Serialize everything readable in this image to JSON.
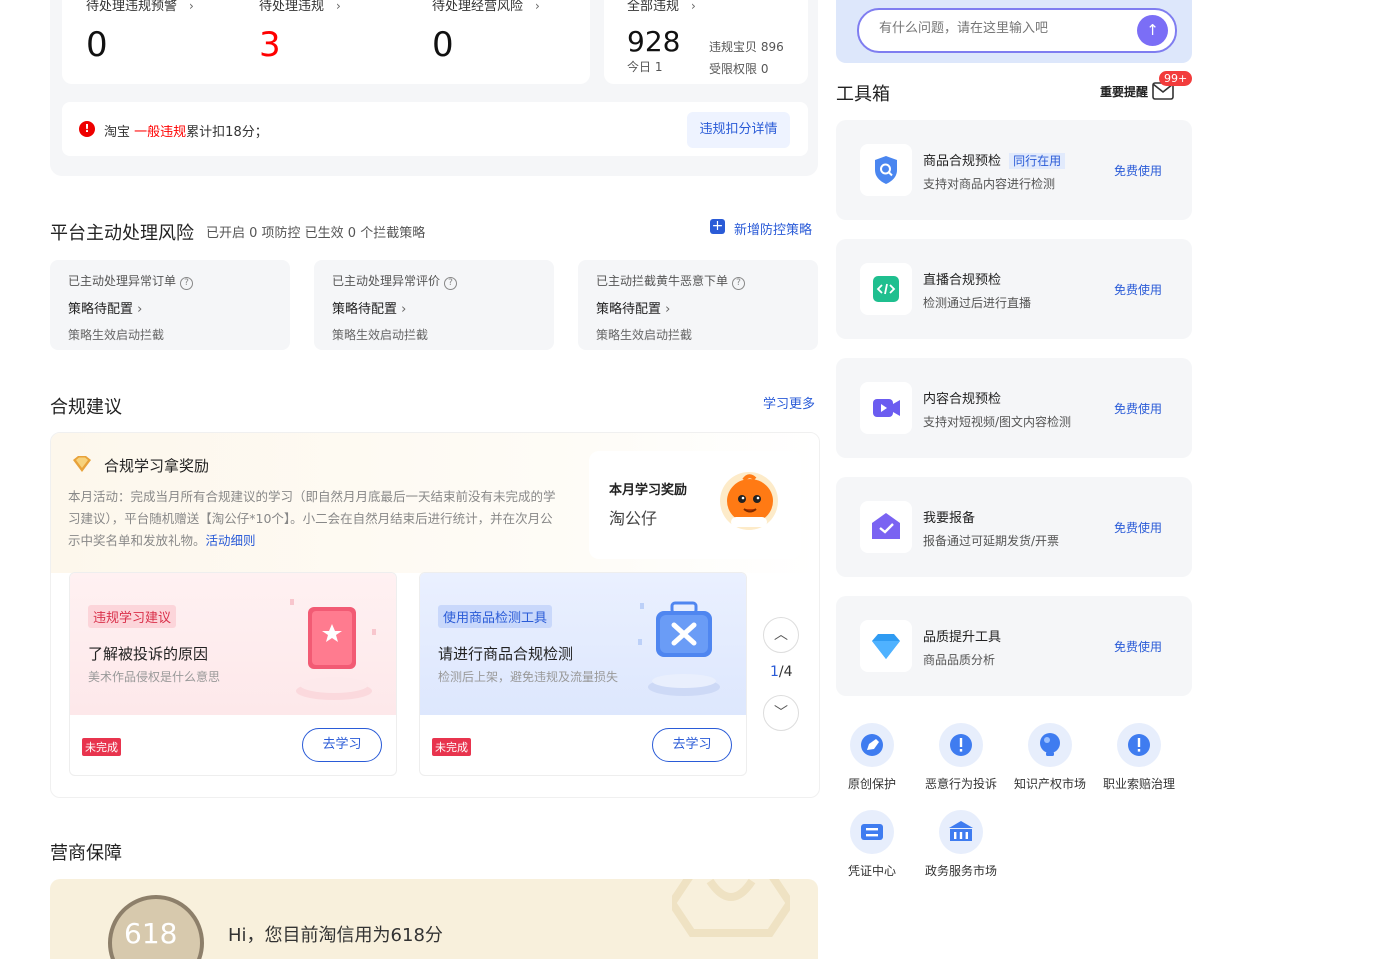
{
  "stats": {
    "pending_warning": {
      "label": "待处理违规预警",
      "value": "0"
    },
    "pending_violation": {
      "label": "待处理违规",
      "value": "3"
    },
    "pending_risk": {
      "label": "待处理经营风险",
      "value": "0"
    },
    "all_violation": {
      "label": "全部违规",
      "value": "928",
      "today": "今日 1",
      "bao": "违规宝贝 896",
      "limit": "受限权限 0"
    }
  },
  "notice": {
    "platform": "淘宝",
    "type": "一般违规",
    "text": "累计扣18分；",
    "button": "违规扣分详情"
  },
  "platform_risk": {
    "title": "平台主动处理风险",
    "summary": "已开启 0 项防控 已生效 0 个拦截策略",
    "add_button": "新增防控策略",
    "cards": [
      {
        "title": "已主动处理异常订单",
        "status": "策略待配置",
        "desc": "策略生效启动拦截"
      },
      {
        "title": "已主动处理异常评价",
        "status": "策略待配置",
        "desc": "策略生效启动拦截"
      },
      {
        "title": "已主动拦截黄牛恶意下单",
        "status": "策略待配置",
        "desc": "策略生效启动拦截"
      }
    ]
  },
  "compliance": {
    "title": "合规建议",
    "more": "学习更多",
    "reward_title": "合规学习拿奖励",
    "reward_text": "本月活动：完成当月所有合规建议的学习（即自然月月底最后一天结束前没有未完成的学习建议），平台随机赠送【淘公仔*10个】。小二会在自然月结束后进行统计，并在次月公示中奖名单和发放礼物。",
    "reward_link": "活动细则",
    "reward_box_title": "本月学习奖励",
    "reward_box_item": "淘公仔",
    "cards": [
      {
        "tag": "违规学习建议",
        "title": "了解被投诉的原因",
        "desc": "美术作品侵权是什么意思",
        "status": "未完成",
        "button": "去学习"
      },
      {
        "tag": "使用商品检测工具",
        "title": "请进行商品合规检测",
        "desc": "检测后上架，避免违规及流量损失",
        "status": "未完成",
        "button": "去学习"
      }
    ],
    "page_current": "1",
    "page_total": "/4"
  },
  "guarantee": {
    "title": "营商保障",
    "score": "618",
    "text": "Hi，您目前淘信用为618分"
  },
  "search": {
    "placeholder": "有什么问题，请在这里输入吧"
  },
  "toolbox": {
    "title": "工具箱",
    "reminder": "重要提醒",
    "badge": "99+",
    "tools": [
      {
        "title": "商品合规预检",
        "tag": "同行在用",
        "desc": "支持对商品内容进行检测",
        "action": "免费使用",
        "icon": "shield-search-icon"
      },
      {
        "title": "直播合规预检",
        "desc": "检测通过后进行直播",
        "action": "免费使用",
        "icon": "code-icon"
      },
      {
        "title": "内容合规预检",
        "desc": "支持对短视频/图文内容检测",
        "action": "免费使用",
        "icon": "video-icon"
      },
      {
        "title": "我要报备",
        "desc": "报备通过可延期发货/开票",
        "action": "免费使用",
        "icon": "check-badge-icon"
      },
      {
        "title": "品质提升工具",
        "desc": "商品品质分析",
        "action": "免费使用",
        "icon": "diamond-icon"
      }
    ]
  },
  "services": [
    {
      "label": "原创保护",
      "icon": "pen-icon"
    },
    {
      "label": "恶意行为投诉",
      "icon": "alert-icon"
    },
    {
      "label": "知识产权市场",
      "icon": "bulb-icon"
    },
    {
      "label": "职业索赔治理",
      "icon": "alert-icon"
    },
    {
      "label": "凭证中心",
      "icon": "ticket-icon"
    },
    {
      "label": "政务服务市场",
      "icon": "building-icon"
    }
  ]
}
